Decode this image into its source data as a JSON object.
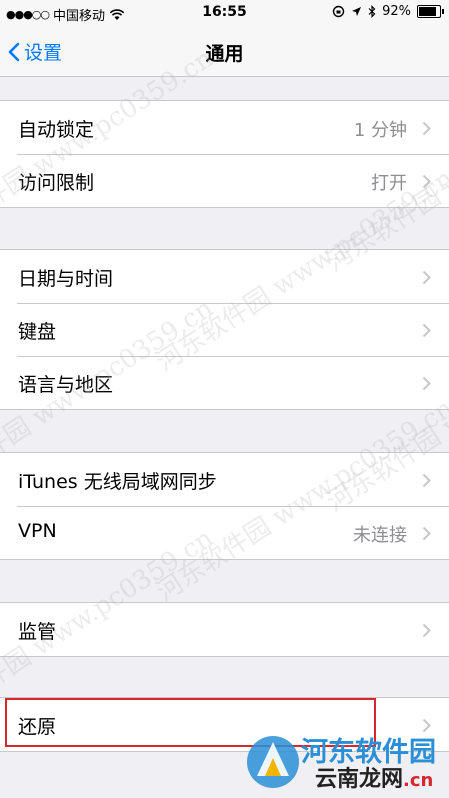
{
  "status_bar": {
    "carrier": "中国移动",
    "time": "16:55",
    "battery": "92%",
    "battery_level": 0.92
  },
  "nav": {
    "back_label": "设置",
    "title": "通用"
  },
  "groups": [
    {
      "rows": [
        {
          "label": "自动锁定",
          "value": "1 分钟"
        },
        {
          "label": "访问限制",
          "value": "打开"
        }
      ]
    },
    {
      "rows": [
        {
          "label": "日期与时间",
          "value": ""
        },
        {
          "label": "键盘",
          "value": ""
        },
        {
          "label": "语言与地区",
          "value": ""
        }
      ]
    },
    {
      "rows": [
        {
          "label": "iTunes 无线局域网同步",
          "value": ""
        },
        {
          "label": "VPN",
          "value": "未连接"
        }
      ]
    },
    {
      "rows": [
        {
          "label": "监管",
          "value": ""
        }
      ]
    },
    {
      "rows": [
        {
          "label": "还原",
          "value": ""
        }
      ]
    }
  ],
  "watermark": {
    "text": "河东软件园 www.pc0359.cn",
    "logo_line1": "河东软件园",
    "logo_line2": "云南龙网",
    "logo_line2_suffix": ".cn"
  },
  "colors": {
    "accent": "#007aff",
    "highlight": "#d7282f",
    "background": "#efeff4"
  }
}
